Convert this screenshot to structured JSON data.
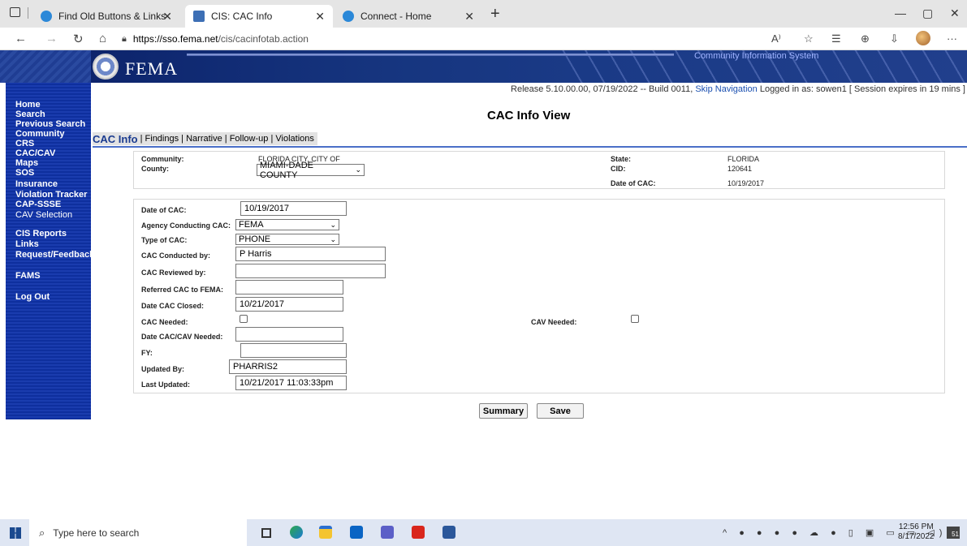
{
  "browser": {
    "tabs": [
      {
        "title": "Find Old Buttons & Links",
        "active": false
      },
      {
        "title": "CIS: CAC Info",
        "active": true
      },
      {
        "title": "Connect - Home",
        "active": false
      }
    ],
    "new_tab_glyph": "+",
    "url": "https://sso.fema.net/cis/cacinfotab.action",
    "url_host": "https://sso.fema.net",
    "url_path": "/cis/cacinfotab.action",
    "more_glyph": "···"
  },
  "header": {
    "agency": "FEMA",
    "system_name": "Community Information System"
  },
  "release_bar": {
    "release": "Release 5.10.00.00, 07/19/2022 -- Build 0011,",
    "skip_nav": "Skip Navigation",
    "logged_in": "Logged in as: sowen1",
    "session": "[ Session expires in 19 mins ]"
  },
  "sidebar": {
    "items": [
      {
        "label": "Home"
      },
      {
        "label": "Search"
      },
      {
        "label": "Previous Search"
      },
      {
        "label": "Community"
      },
      {
        "label": "CRS"
      },
      {
        "label": "CAC/CAV"
      },
      {
        "label": "Maps"
      },
      {
        "label": "SOS"
      },
      {
        "label": "Insurance"
      },
      {
        "label": "Violation Tracker"
      },
      {
        "label": "CAP-SSSE"
      },
      {
        "label": "CAV Selection"
      },
      {
        "label": "CIS Reports"
      },
      {
        "label": "Links"
      },
      {
        "label": "Request/Feedback"
      },
      {
        "label": "FAMS"
      },
      {
        "label": "Log Out"
      }
    ]
  },
  "page": {
    "title": "CAC Info View",
    "tabs": [
      {
        "label": "CAC Info"
      },
      {
        "label": "Findings"
      },
      {
        "label": "Narrative"
      },
      {
        "label": "Follow-up"
      },
      {
        "label": "Violations"
      }
    ],
    "tab_separator": "|"
  },
  "community_info": {
    "community_label": "Community:",
    "community_value": "FLORIDA CITY, CITY OF",
    "county_label": "County:",
    "county_value": "MIAMI-DADE COUNTY",
    "state_label": "State:",
    "state_value": "FLORIDA",
    "cid_label": "CID:",
    "cid_value": "120641",
    "date_label": "Date of CAC:",
    "date_value": "10/19/2017"
  },
  "form": {
    "date_of_cac": {
      "label": "Date of CAC:",
      "value": "10/19/2017"
    },
    "agency": {
      "label": "Agency Conducting CAC:",
      "value": "FEMA"
    },
    "type": {
      "label": "Type of CAC:",
      "value": "PHONE"
    },
    "conducted_by": {
      "label": "CAC Conducted by:",
      "value": "P Harris"
    },
    "reviewed_by": {
      "label": "CAC Reviewed by:",
      "value": ""
    },
    "referred": {
      "label": "Referred CAC to FEMA:",
      "value": ""
    },
    "date_closed": {
      "label": "Date CAC Closed:",
      "value": "10/21/2017"
    },
    "cac_needed": {
      "label": "CAC Needed:",
      "checked": false
    },
    "cav_needed": {
      "label": "CAV Needed:",
      "checked": false
    },
    "date_needed": {
      "label": "Date CAC/CAV Needed:",
      "value": ""
    },
    "fy": {
      "label": "FY:",
      "value": ""
    },
    "updated_by": {
      "label": "Updated By:",
      "value": "PHARRIS2"
    },
    "last_updated": {
      "label": "Last Updated:",
      "value": "10/21/2017 11:03:33pm"
    }
  },
  "buttons": {
    "summary": "Summary",
    "save": "Save"
  },
  "taskbar": {
    "search_placeholder": "Type here to search",
    "time": "12:56 PM",
    "date": "8/17/2022",
    "notification_count": "51"
  },
  "colors": {
    "sidebar": "#1a3cae",
    "banner": "#16357f",
    "link": "#1a4fb0",
    "tab_active_text": "#1a3b8f"
  }
}
